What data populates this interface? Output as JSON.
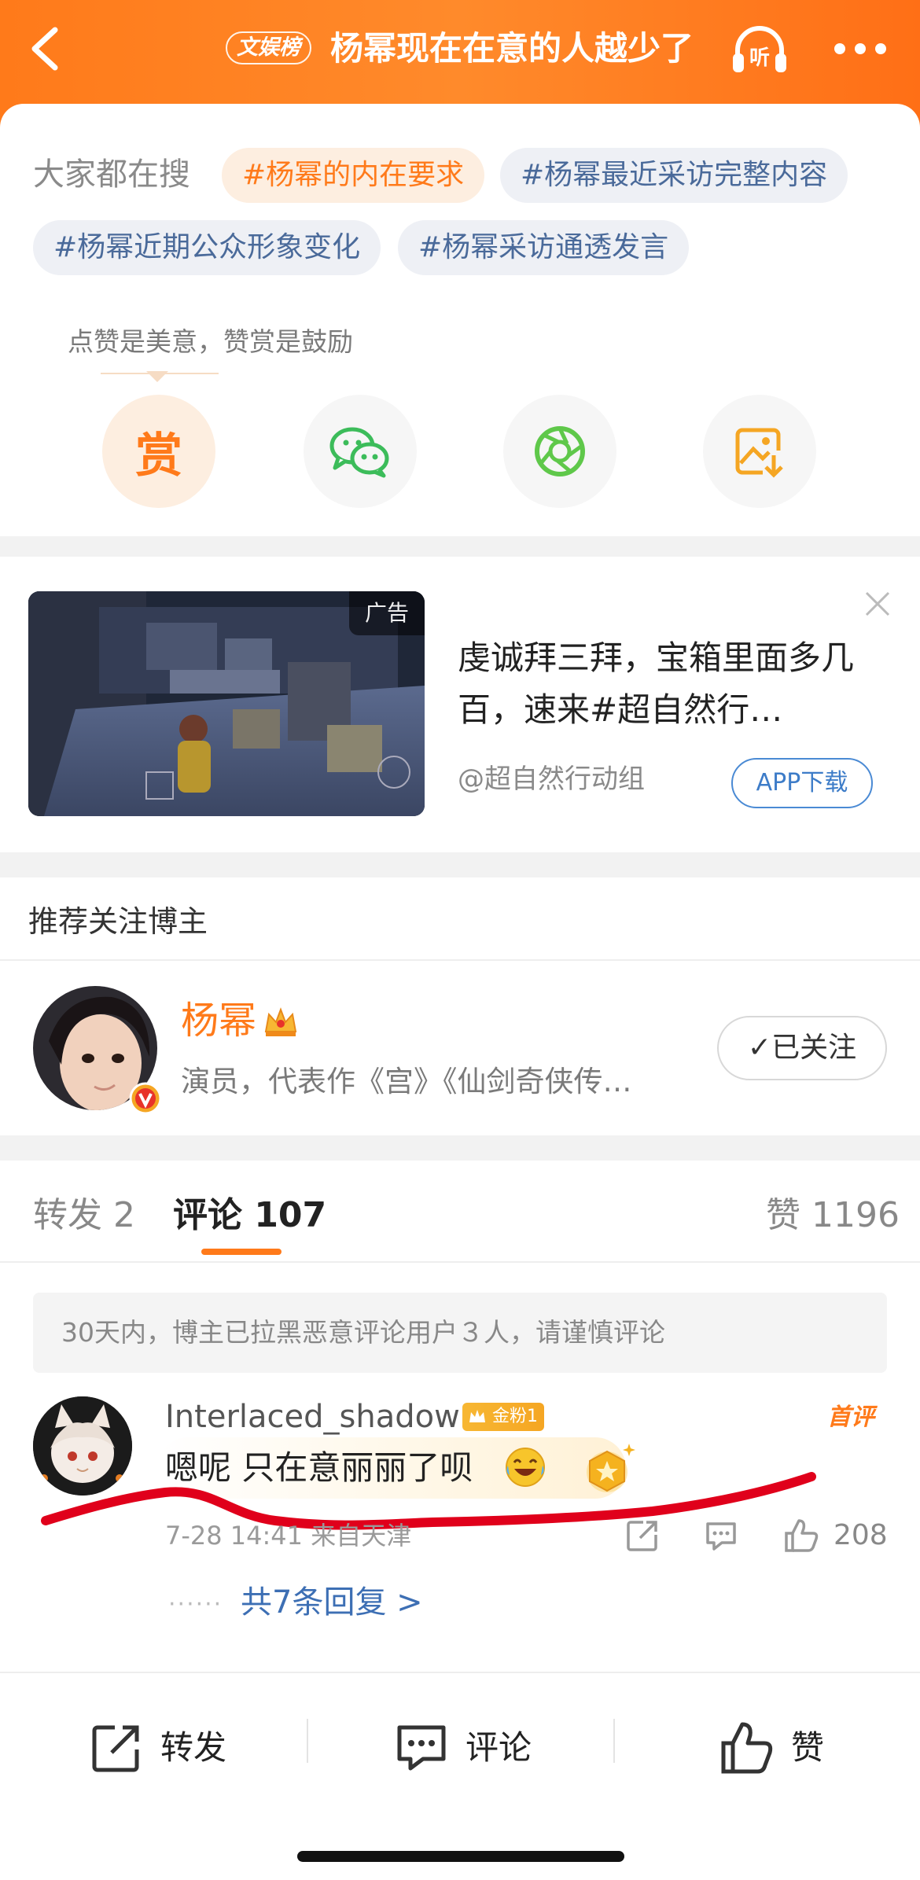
{
  "header": {
    "tag": "文娱榜",
    "title": "杨幂现在在意的人越少了",
    "listen_label": "听"
  },
  "hot_search": {
    "label": "大家都在搜",
    "chips": [
      "#杨幂的内在要求",
      "#杨幂最近采访完整内容",
      "#杨幂近期公众形象变化",
      "#杨幂采访通透发言"
    ]
  },
  "share": {
    "tip": "点赞是美意，赞赏是鼓励",
    "reward_label": "赏"
  },
  "ad": {
    "badge": "广告",
    "text": "虔诚拜三拜，宝箱里面多几百，速来#超自然行…",
    "source": "@超自然行动组",
    "download_label": "APP下载"
  },
  "recommend": {
    "title": "推荐关注博主",
    "name": "杨幂",
    "desc": "演员，代表作《宫》《仙剑奇侠传…",
    "follow_label": "✓已关注"
  },
  "tabs": {
    "repost_label": "转发 2",
    "comment_label": "评论 107",
    "like_label": "赞 1196"
  },
  "notice": "30天内，博主已拉黑恶意评论用户３人，请谨慎评论",
  "comment": {
    "user": "Interlaced_shadow",
    "fan_badge": "金粉1",
    "first_tag": "首评",
    "text": "嗯呢 只在意丽丽了呗",
    "meta": "7-28 14:41 来自天津",
    "likes": "208",
    "dots": "······",
    "replies": "共7条回复 >"
  },
  "bottom_bar": {
    "repost": "转发",
    "comment": "评论",
    "like": "赞"
  },
  "colors": {
    "brand": "#ff7a1a",
    "link": "#3d6fb4",
    "scribble": "#e0001b"
  }
}
